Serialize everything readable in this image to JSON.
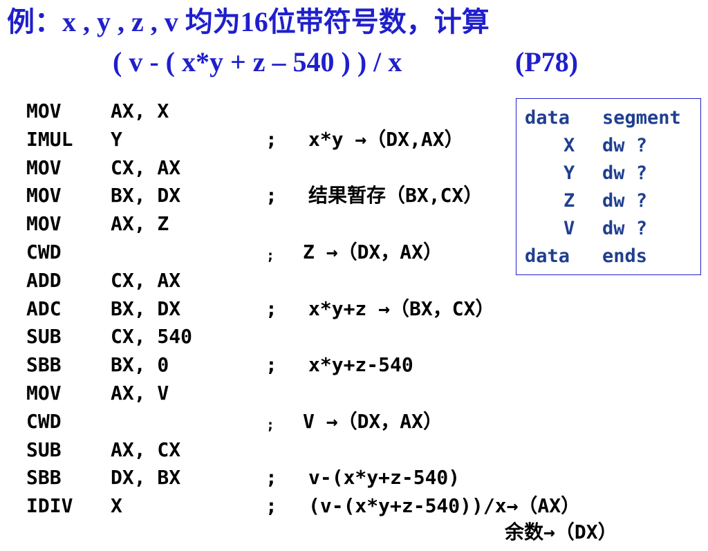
{
  "title": {
    "line1": "例：x , y , z , v 均为16位带符号数，计算",
    "line2": "( v - ( x*y + z – 540 ) ) / x",
    "reference": "(P78)"
  },
  "code": [
    {
      "op": "MOV",
      "args": "AX, X",
      "semi": "",
      "comment": ""
    },
    {
      "op": "IMUL",
      "args": "Y",
      "semi": ";",
      "comment": "x*y →（DX,AX）"
    },
    {
      "op": "MOV",
      "args": "CX, AX",
      "semi": "",
      "comment": ""
    },
    {
      "op": "MOV",
      "args": "BX, DX",
      "semi": ";",
      "comment": "结果暂存（BX,CX）"
    },
    {
      "op": "MOV",
      "args": "AX, Z",
      "semi": "",
      "comment": ""
    },
    {
      "op": "CWD",
      "args": "",
      "semi": ";",
      "comment": "Z →（DX，AX）"
    },
    {
      "op": "ADD",
      "args": "CX, AX",
      "semi": "",
      "comment": ""
    },
    {
      "op": "ADC",
      "args": "BX, DX",
      "semi": ";",
      "comment": "x*y+z →（BX，CX）"
    },
    {
      "op": "SUB",
      "args": "CX, 540",
      "semi": "",
      "comment": ""
    },
    {
      "op": "SBB",
      "args": "BX, 0",
      "semi": ";",
      "comment": "x*y+z-540"
    },
    {
      "op": "MOV",
      "args": "AX, V",
      "semi": "",
      "comment": ""
    },
    {
      "op": "CWD",
      "args": "",
      "semi": ";",
      "comment": "V →（DX，AX）"
    },
    {
      "op": "SUB",
      "args": "AX, CX",
      "semi": "",
      "comment": ""
    },
    {
      "op": "SBB",
      "args": "DX, BX",
      "semi": ";",
      "comment": "v-(x*y+z-540)"
    },
    {
      "op": "IDIV",
      "args": "X",
      "semi": ";",
      "comment": "(v-(x*y+z-540))/x→（AX）"
    }
  ],
  "remainder": "余数→（DX）",
  "data_segment": {
    "open_keyword": "data",
    "open_directive": "segment",
    "vars": [
      {
        "name": "X",
        "type": "dw ?"
      },
      {
        "name": "Y",
        "type": "dw ?"
      },
      {
        "name": "Z",
        "type": "dw ?"
      },
      {
        "name": "V",
        "type": "dw ?"
      }
    ],
    "close_keyword": "data",
    "close_directive": "ends"
  },
  "colors": {
    "title": "#1f1fcc",
    "code": "#000000",
    "data_text": "#1f3f8f",
    "data_border": "#1f1fcc"
  }
}
